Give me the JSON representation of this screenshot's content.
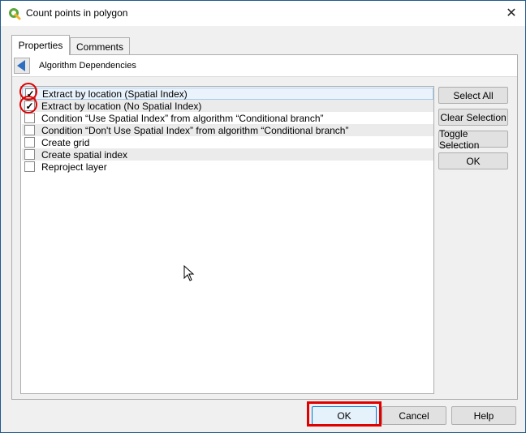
{
  "window": {
    "title": "Count points in polygon"
  },
  "tabs": [
    {
      "label": "Properties",
      "active": true
    },
    {
      "label": "Comments",
      "active": false
    }
  ],
  "header": {
    "label": "Algorithm Dependencies"
  },
  "list": {
    "items": [
      {
        "label": "Extract by location (Spatial Index)",
        "checked": true
      },
      {
        "label": "Extract by location (No Spatial Index)",
        "checked": true
      },
      {
        "label": "Condition “Use Spatial Index” from algorithm “Conditional branch”",
        "checked": false
      },
      {
        "label": "Condition “Don't Use Spatial Index” from algorithm “Conditional branch”",
        "checked": false
      },
      {
        "label": "Create grid",
        "checked": false
      },
      {
        "label": "Create spatial index",
        "checked": false
      },
      {
        "label": "Reproject layer",
        "checked": false
      }
    ]
  },
  "side_buttons": {
    "select_all": "Select All",
    "clear_selection": "Clear Selection",
    "toggle_selection": "Toggle Selection",
    "ok": "OK"
  },
  "footer": {
    "ok": "OK",
    "cancel": "Cancel",
    "help": "Help"
  },
  "colors": {
    "highlight": "#e00000",
    "selection_bg": "#eaf3fc",
    "accent": "#2f6fbf"
  },
  "icons": {
    "app": "qgis-logo-icon",
    "close": "close-icon",
    "back": "back-arrow-icon",
    "cursor": "mouse-pointer-icon"
  }
}
